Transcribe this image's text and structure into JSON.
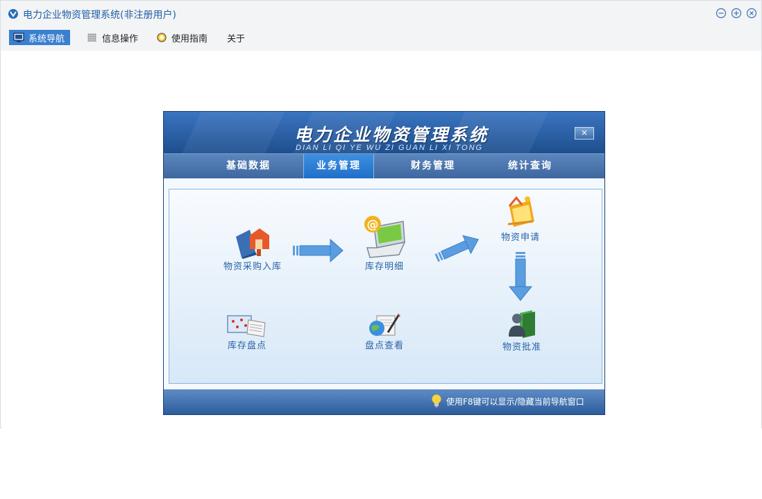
{
  "window": {
    "title": "电力企业物资管理系统(非注册用户)",
    "icon": "app-logo-icon",
    "controls": [
      "minimize-icon",
      "maximize-icon",
      "close-icon"
    ]
  },
  "menu": {
    "items": [
      {
        "label": "系统导航",
        "icon": "monitor-icon",
        "active": true
      },
      {
        "label": "信息操作",
        "icon": "grid-icon",
        "active": false
      },
      {
        "label": "使用指南",
        "icon": "guide-icon",
        "active": false
      },
      {
        "label": "关于",
        "icon": "",
        "active": false
      }
    ]
  },
  "nav": {
    "title": "电力企业物资管理系统",
    "subtitle": "DIAN LI QI YE WU ZI GUAN LI XI TONG",
    "close_label": "×",
    "tabs": [
      {
        "label": "基础数据",
        "active": false
      },
      {
        "label": "业务管理",
        "active": true
      },
      {
        "label": "财务管理",
        "active": false
      },
      {
        "label": "统计查询",
        "active": false
      }
    ],
    "functions": {
      "purchase": {
        "label": "物资采购入库",
        "icon": "book-house-icon"
      },
      "inventory_detail": {
        "label": "库存明细",
        "icon": "laptop-email-icon"
      },
      "apply": {
        "label": "物资申请",
        "icon": "apply-folder-icon"
      },
      "approve": {
        "label": "物资批准",
        "icon": "user-book-icon"
      },
      "stocktake": {
        "label": "库存盘点",
        "icon": "map-document-icon"
      },
      "stocktake_view": {
        "label": "盘点查看",
        "icon": "globe-document-icon"
      }
    },
    "footer_tip": "使用F8键可以显示/隐藏当前导航窗口"
  },
  "colors": {
    "accent": "#3a7fd0",
    "title_text": "#1f5fa6",
    "nav_dark": "#1e4f8e",
    "function_label": "#2a62a8",
    "arrow": "#5a9de0"
  }
}
